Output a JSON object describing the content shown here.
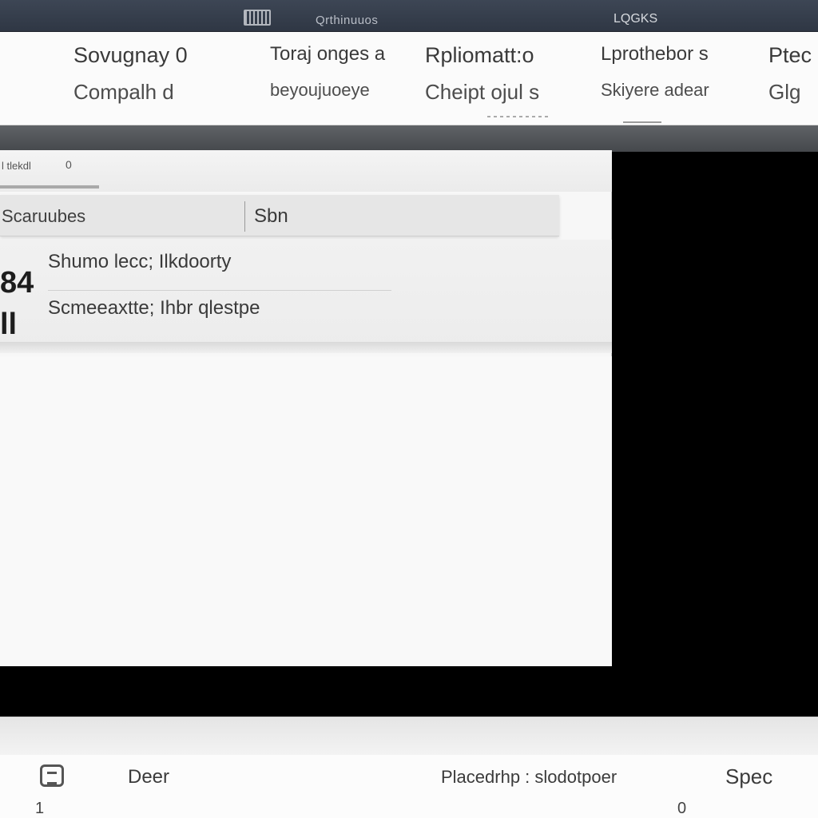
{
  "titlebar": {
    "app_icon": "grid-icon",
    "title": "Qrthinuuos",
    "subtitle": "LQGKS"
  },
  "menu": {
    "columns": [
      {
        "line1": "Sovugnay 0",
        "line2": "Compalh d"
      },
      {
        "line1": "Toraj onges a",
        "line2": "beyoujuoeye"
      },
      {
        "line1": "Rpliomatt:o",
        "line2": "Cheipt ojul s"
      },
      {
        "line1": "Lprothebor s",
        "line2": "Skiyere adear"
      },
      {
        "line1": "Ptec",
        "line2": "Glg"
      }
    ]
  },
  "dialog": {
    "title": "l tlekdl",
    "close_icon": "close-icon",
    "close_label": "0",
    "field_label": "Scaruubes",
    "field_value": "Sbn",
    "side_glyph": "84\nll",
    "items": [
      "Shumo lecc; Ilkdoorty",
      "Scmeeaxtte; Ihbr qlestpe"
    ]
  },
  "statusbar": {
    "icon": "printer-icon",
    "left_label": "Deer",
    "mid_label": "Placedrhp : slodotpoer",
    "right_label": "Spec",
    "left_number": "1",
    "right_number": "0"
  },
  "colors": {
    "titlebar": "#353d4a",
    "menubar": "#fbfbfb",
    "band": "#55585c",
    "dialog": "#f7f7f7",
    "backdrop": "#000000"
  }
}
